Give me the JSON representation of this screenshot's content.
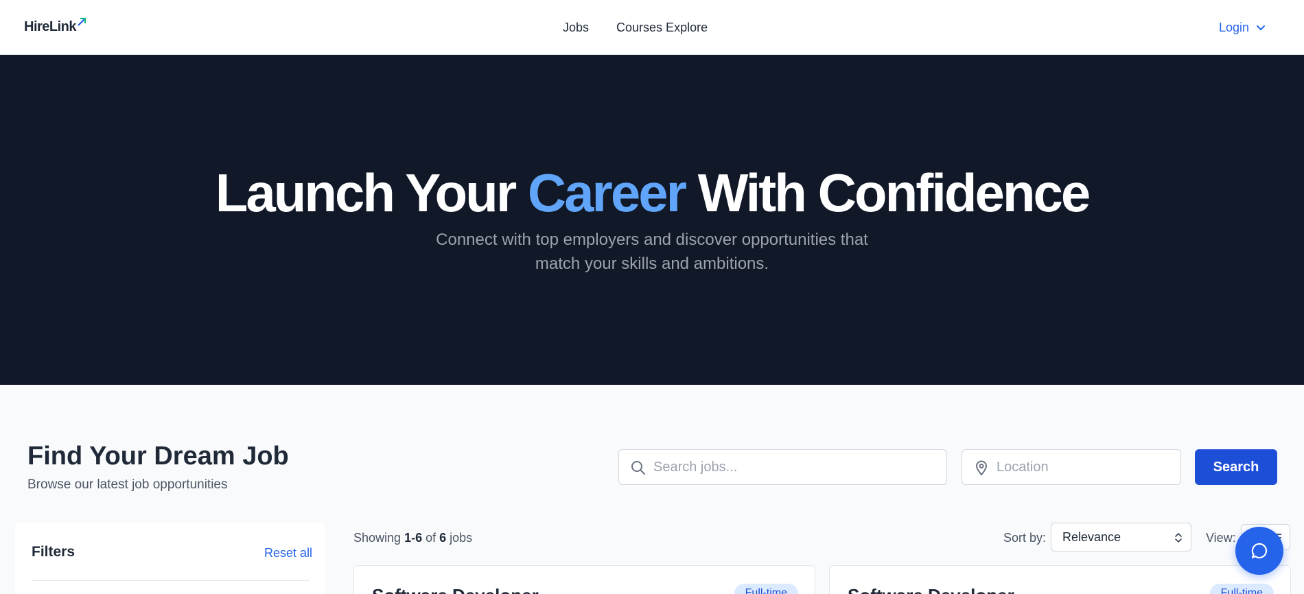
{
  "header": {
    "logo_text": "HireLink",
    "nav": [
      {
        "label": "Jobs"
      },
      {
        "label": "Courses Explore"
      }
    ],
    "login_label": "Login"
  },
  "hero": {
    "title_part1": "Launch Your ",
    "title_accent": "Career",
    "title_part2": " With Confidence",
    "subtitle": "Connect with top employers and discover opportunities that match your skills and ambitions."
  },
  "search_section": {
    "title": "Find Your Dream Job",
    "subtitle": "Browse our latest job opportunities",
    "search_placeholder": "Search jobs...",
    "location_placeholder": "Location",
    "search_button": "Search"
  },
  "filters": {
    "title": "Filters",
    "reset_label": "Reset all"
  },
  "results": {
    "showing_prefix": "Showing ",
    "showing_range": "1-6",
    "showing_of": " of ",
    "showing_total": "6",
    "showing_suffix": " jobs",
    "sort_label": "Sort by:",
    "sort_value": "Relevance",
    "view_label": "View:"
  },
  "jobs": [
    {
      "title": "Software Developer",
      "type": "Full-time"
    },
    {
      "title": "Software Developer",
      "type": "Full-time"
    }
  ],
  "colors": {
    "brand": "#2563eb",
    "hero_bg": "#111827",
    "accent_text": "#60a5fa",
    "search_button": "#1d4ed8"
  },
  "icons": {
    "logo_mark": "arrow-up-right-icon",
    "login_chevron": "chevron-down-icon",
    "search": "search-icon",
    "location": "map-pin-icon",
    "sort": "chevron-up-down-icon",
    "view": "list-view-icon",
    "chat": "chat-bubble-icon"
  }
}
